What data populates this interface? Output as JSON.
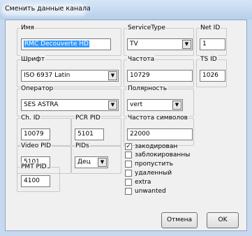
{
  "window": {
    "title": "Сменить данные канала"
  },
  "fields": {
    "name": {
      "label": "Имя",
      "value": "RMC Decouverte HD"
    },
    "service_type": {
      "label": "ServiceType",
      "value": "TV"
    },
    "net_id": {
      "label": "Net ID",
      "value": "1"
    },
    "font": {
      "label": "Шрифт",
      "value": "ISO 6937 Latin"
    },
    "frequency": {
      "label": "Частота",
      "value": "10729"
    },
    "ts_id": {
      "label": "TS ID",
      "value": "1026"
    },
    "operator": {
      "label": "Оператор",
      "value": "SES ASTRA"
    },
    "polarity": {
      "label": "Полярность",
      "value": "vert"
    },
    "ch_id": {
      "label": "Ch. ID",
      "value": "10079"
    },
    "pcr_pid": {
      "label": "PCR PID",
      "value": "5101"
    },
    "symbol_rate": {
      "label": "Частота символов",
      "value": "22000"
    },
    "video_pid": {
      "label": "Video PID",
      "value": "5101"
    },
    "pids": {
      "label": "PIDs",
      "value": "Дец"
    },
    "pmt_pid": {
      "label": "PMT PID",
      "value": "4100"
    }
  },
  "checkboxes": [
    {
      "label": "закодирован",
      "checked": true
    },
    {
      "label": "заблокированны",
      "checked": false
    },
    {
      "label": "пропустить",
      "checked": false
    },
    {
      "label": "удаленный",
      "checked": false
    },
    {
      "label": "extra",
      "checked": false
    },
    {
      "label": "unwanted",
      "checked": false
    }
  ],
  "buttons": {
    "cancel": "Отмена",
    "ok": "OK"
  },
  "glyphs": {
    "dropdown_arrow": "▼",
    "check_mark": "✓"
  }
}
